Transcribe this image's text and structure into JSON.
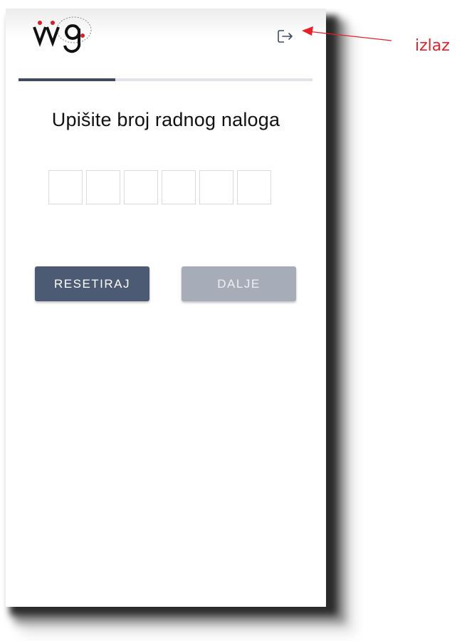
{
  "header": {
    "logo_text": "vvg",
    "exit_icon": "exit-icon"
  },
  "progress": {
    "fraction": 0.33
  },
  "main": {
    "title": "Upišite broj radnog naloga",
    "code_boxes": [
      "",
      "",
      "",
      "",
      "",
      ""
    ]
  },
  "buttons": {
    "reset_label": "RESETIRAJ",
    "next_label": "DALJE"
  },
  "annotation": {
    "label": "izlaz"
  },
  "colors": {
    "primary": "#4c5a73",
    "disabled": "#a6adb8",
    "progress": "#3e4b63",
    "annotation": "#e8202a",
    "logo_dot": "#d41f26"
  }
}
